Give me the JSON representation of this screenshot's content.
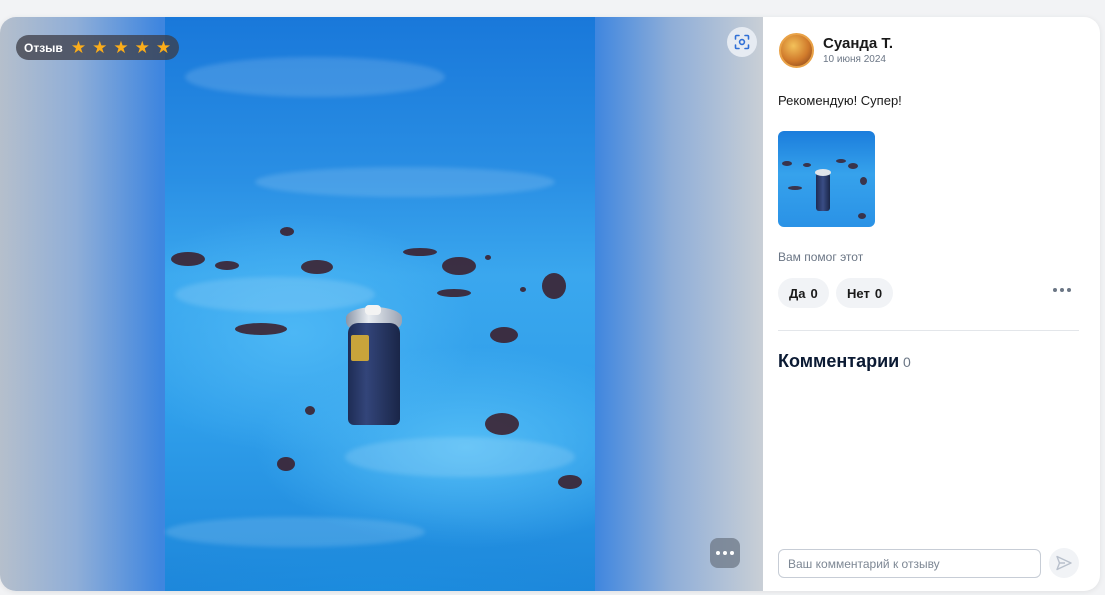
{
  "review": {
    "badge_label": "Отзыв",
    "rating": 5,
    "stars": [
      "★",
      "★",
      "★",
      "★",
      "★"
    ],
    "author": "Суанда Т.",
    "date": "10 июня 2024",
    "text": "Рекомендую! Супер!"
  },
  "helpful": {
    "question": "Вам помог этот",
    "yes_label": "Да",
    "yes_count": "0",
    "no_label": "Нет",
    "no_count": "0"
  },
  "comments": {
    "title": "Комментарии",
    "count": "0",
    "input_placeholder": "Ваш комментарий к отзыву"
  },
  "icons": {
    "expand": "expand-icon",
    "more": "more-dots-icon",
    "send": "send-icon",
    "star": "star-icon"
  },
  "colors": {
    "star": "#fbad1a",
    "title": "#0b1a33",
    "muted": "#6b7685",
    "pill_bg": "#f1f3f6"
  }
}
